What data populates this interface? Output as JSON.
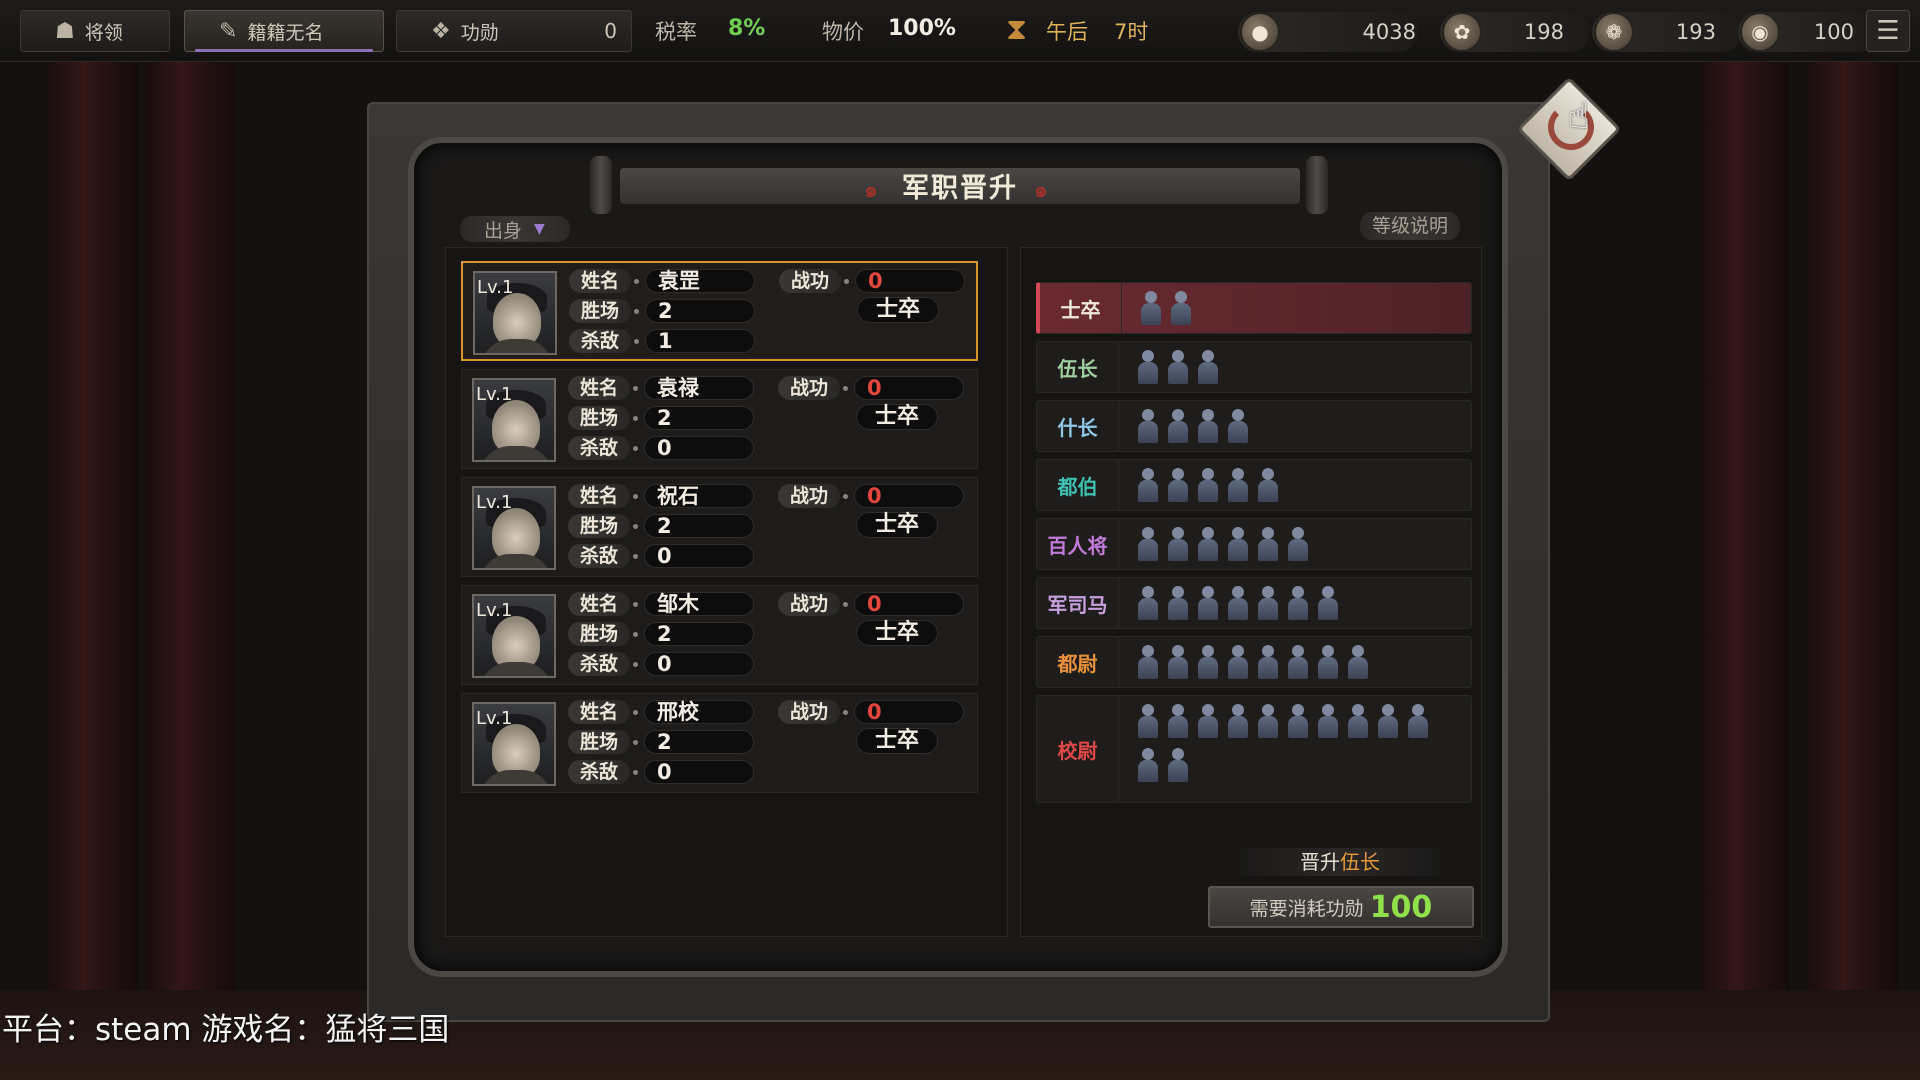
{
  "topbar": {
    "tabs": [
      {
        "label": "将领",
        "icon": "general-icon"
      },
      {
        "label": "籍籍无名",
        "icon": "scroll-icon"
      },
      {
        "label": "功勋",
        "icon": "medal-icon",
        "value": "0"
      }
    ],
    "tax_label": "税率",
    "tax_value": "8%",
    "price_label": "物价",
    "price_value": "100%",
    "time_label": "午后",
    "time_value": "7时",
    "resources": [
      {
        "icon": "coins-icon",
        "value": "4038"
      },
      {
        "icon": "grain-icon",
        "value": "198"
      },
      {
        "icon": "rice-icon",
        "value": "193"
      },
      {
        "icon": "eye-icon",
        "value": "100"
      }
    ]
  },
  "panel": {
    "title": "军职晋升",
    "filter_label": "出身",
    "help_label": "等级说明"
  },
  "field_labels": {
    "name": "姓名",
    "wins": "胜场",
    "kills": "杀敌",
    "merit": "战功"
  },
  "soldiers": [
    {
      "level": "Lv.1",
      "name": "袁罡",
      "wins": "2",
      "kills": "1",
      "merit": "0",
      "rank": "士卒"
    },
    {
      "level": "Lv.1",
      "name": "袁禄",
      "wins": "2",
      "kills": "0",
      "merit": "0",
      "rank": "士卒"
    },
    {
      "level": "Lv.1",
      "name": "祝石",
      "wins": "2",
      "kills": "0",
      "merit": "0",
      "rank": "士卒"
    },
    {
      "level": "Lv.1",
      "name": "邹木",
      "wins": "2",
      "kills": "0",
      "merit": "0",
      "rank": "士卒"
    },
    {
      "level": "Lv.1",
      "name": "邢校",
      "wins": "2",
      "kills": "0",
      "merit": "0",
      "rank": "士卒"
    }
  ],
  "ranks": [
    {
      "name": "士卒",
      "count": 2,
      "color": "#f0e8dc"
    },
    {
      "name": "伍长",
      "count": 3,
      "color": "#9fd0a0"
    },
    {
      "name": "什长",
      "count": 4,
      "color": "#8fc8e8"
    },
    {
      "name": "都伯",
      "count": 5,
      "color": "#3fc0b0"
    },
    {
      "name": "百人将",
      "count": 6,
      "color": "#c27ad8"
    },
    {
      "name": "军司马",
      "count": 7,
      "color": "#c8a0e0"
    },
    {
      "name": "都尉",
      "count": 8,
      "color": "#e8903a"
    },
    {
      "name": "校尉",
      "count": 12,
      "color": "#e04848"
    }
  ],
  "promotion": {
    "prefix": "晋升",
    "target": "伍长",
    "cost_label": "需要消耗功勋",
    "cost_value": "100"
  },
  "watermark": "平台：steam 游戏名：猛将三国"
}
